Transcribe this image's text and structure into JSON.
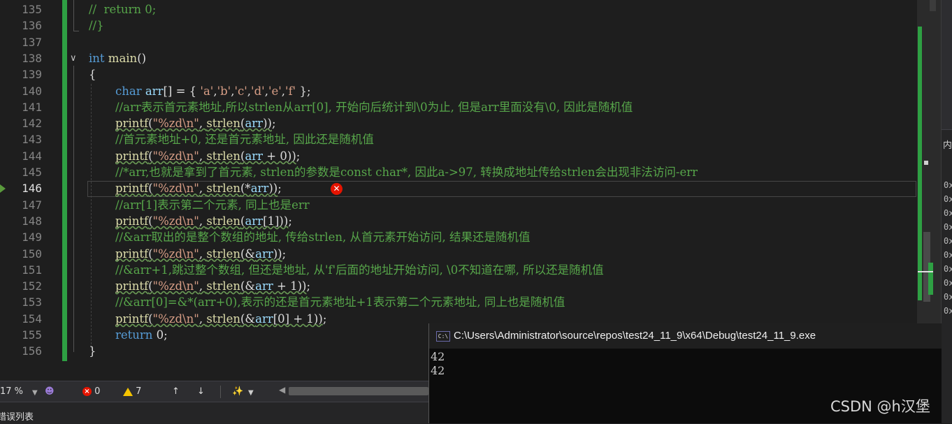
{
  "editor": {
    "lines": [
      {
        "num": "135",
        "parts": [
          {
            "c": "comment",
            "t": "//  return 0;"
          }
        ]
      },
      {
        "num": "136",
        "parts": [
          {
            "c": "comment",
            "t": "//}"
          }
        ]
      },
      {
        "num": "137",
        "parts": []
      },
      {
        "num": "138",
        "parts": [
          {
            "c": "kw",
            "t": "int"
          },
          {
            "c": "plain",
            "t": " "
          },
          {
            "c": "fn",
            "t": "main"
          },
          {
            "c": "plain",
            "t": "()"
          }
        ]
      },
      {
        "num": "139",
        "parts": [
          {
            "c": "plain",
            "t": "{"
          }
        ]
      },
      {
        "num": "140",
        "indent": true,
        "parts": [
          {
            "c": "kw",
            "t": "char"
          },
          {
            "c": "plain",
            "t": " "
          },
          {
            "c": "var",
            "t": "arr"
          },
          {
            "c": "plain",
            "t": "[] = { "
          },
          {
            "c": "str",
            "t": "'a'"
          },
          {
            "c": "plain",
            "t": ","
          },
          {
            "c": "str",
            "t": "'b'"
          },
          {
            "c": "plain",
            "t": ","
          },
          {
            "c": "str",
            "t": "'c'"
          },
          {
            "c": "plain",
            "t": ","
          },
          {
            "c": "str",
            "t": "'d'"
          },
          {
            "c": "plain",
            "t": ","
          },
          {
            "c": "str",
            "t": "'e'"
          },
          {
            "c": "plain",
            "t": ","
          },
          {
            "c": "str",
            "t": "'f'"
          },
          {
            "c": "plain",
            "t": " };"
          }
        ]
      },
      {
        "num": "141",
        "indent": true,
        "parts": [
          {
            "c": "comment",
            "t": "//arr表示首元素地址,所以strlen从arr[0], 开始向后统计到\\0为止, 但是arr里面没有\\0, 因此是随机值"
          }
        ]
      },
      {
        "num": "142",
        "indent": true,
        "parts": [
          {
            "c": "fn squig",
            "t": "printf"
          },
          {
            "c": "plain squig",
            "t": "("
          },
          {
            "c": "str squig",
            "t": "\"%zd\\n\""
          },
          {
            "c": "plain squig",
            "t": ", "
          },
          {
            "c": "fn squig",
            "t": "strlen"
          },
          {
            "c": "plain squig",
            "t": "("
          },
          {
            "c": "var squig",
            "t": "arr"
          },
          {
            "c": "plain squig",
            "t": "))"
          },
          {
            "c": "plain",
            "t": ";"
          }
        ]
      },
      {
        "num": "143",
        "indent": true,
        "parts": [
          {
            "c": "comment",
            "t": "//首元素地址+0, 还是首元素地址, 因此还是随机值"
          }
        ]
      },
      {
        "num": "144",
        "indent": true,
        "parts": [
          {
            "c": "fn squig",
            "t": "printf"
          },
          {
            "c": "plain squig",
            "t": "("
          },
          {
            "c": "str squig",
            "t": "\"%zd\\n\""
          },
          {
            "c": "plain squig",
            "t": ", "
          },
          {
            "c": "fn squig",
            "t": "strlen"
          },
          {
            "c": "plain squig",
            "t": "("
          },
          {
            "c": "var squig",
            "t": "arr"
          },
          {
            "c": "plain squig",
            "t": " + 0))"
          },
          {
            "c": "plain",
            "t": ";"
          }
        ]
      },
      {
        "num": "145",
        "indent": true,
        "parts": [
          {
            "c": "comment",
            "t": "//*arr,也就是拿到了首元素, strlen的参数是const char*, 因此a->97, 转换成地址传给strlen会出现非法访问-err"
          }
        ]
      },
      {
        "num": "146",
        "indent": true,
        "active": true,
        "parts": [
          {
            "c": "fn squig",
            "t": "printf"
          },
          {
            "c": "plain squig",
            "t": "("
          },
          {
            "c": "str squig",
            "t": "\"%zd\\n\""
          },
          {
            "c": "plain squig",
            "t": ", "
          },
          {
            "c": "fn squig",
            "t": "strlen"
          },
          {
            "c": "plain squig",
            "t": "(*"
          },
          {
            "c": "var squig",
            "t": "arr"
          },
          {
            "c": "plain squig",
            "t": "))"
          },
          {
            "c": "plain",
            "t": ";"
          }
        ]
      },
      {
        "num": "147",
        "indent": true,
        "parts": [
          {
            "c": "comment",
            "t": "//arr[1]表示第二个元素, 同上也是err"
          }
        ]
      },
      {
        "num": "148",
        "indent": true,
        "parts": [
          {
            "c": "fn squig",
            "t": "printf"
          },
          {
            "c": "plain squig",
            "t": "("
          },
          {
            "c": "str squig",
            "t": "\"%zd\\n\""
          },
          {
            "c": "plain squig",
            "t": ", "
          },
          {
            "c": "fn squig",
            "t": "strlen"
          },
          {
            "c": "plain squig",
            "t": "("
          },
          {
            "c": "var squig",
            "t": "arr"
          },
          {
            "c": "plain squig",
            "t": "[1]))"
          },
          {
            "c": "plain",
            "t": ";"
          }
        ]
      },
      {
        "num": "149",
        "indent": true,
        "parts": [
          {
            "c": "comment",
            "t": "//&arr取出的是整个数组的地址, 传给strlen, 从首元素开始访问, 结果还是随机值"
          }
        ]
      },
      {
        "num": "150",
        "indent": true,
        "parts": [
          {
            "c": "fn squig",
            "t": "printf"
          },
          {
            "c": "plain squig",
            "t": "("
          },
          {
            "c": "str squig",
            "t": "\"%zd\\n\""
          },
          {
            "c": "plain squig",
            "t": ", "
          },
          {
            "c": "fn squig",
            "t": "strlen"
          },
          {
            "c": "plain squig",
            "t": "(&"
          },
          {
            "c": "var squig",
            "t": "arr"
          },
          {
            "c": "plain squig",
            "t": "))"
          },
          {
            "c": "plain",
            "t": ";"
          }
        ]
      },
      {
        "num": "151",
        "indent": true,
        "parts": [
          {
            "c": "comment",
            "t": "//&arr+1,跳过整个数组, 但还是地址, 从'f'后面的地址开始访问, \\0不知道在哪, 所以还是随机值"
          }
        ]
      },
      {
        "num": "152",
        "indent": true,
        "parts": [
          {
            "c": "fn squig",
            "t": "printf"
          },
          {
            "c": "plain squig",
            "t": "("
          },
          {
            "c": "str squig",
            "t": "\"%zd\\n\""
          },
          {
            "c": "plain squig",
            "t": ", "
          },
          {
            "c": "fn squig",
            "t": "strlen"
          },
          {
            "c": "plain squig",
            "t": "(&"
          },
          {
            "c": "var squig",
            "t": "arr"
          },
          {
            "c": "plain squig",
            "t": " + 1))"
          },
          {
            "c": "plain",
            "t": ";"
          }
        ]
      },
      {
        "num": "153",
        "indent": true,
        "parts": [
          {
            "c": "comment",
            "t": "//&arr[0]=&*(arr+0),表示的还是首元素地址+1表示第二个元素地址, 同上也是随机值"
          }
        ]
      },
      {
        "num": "154",
        "indent": true,
        "parts": [
          {
            "c": "fn squig",
            "t": "printf"
          },
          {
            "c": "plain squig",
            "t": "("
          },
          {
            "c": "str squig",
            "t": "\"%zd\\n\""
          },
          {
            "c": "plain squig",
            "t": ", "
          },
          {
            "c": "fn squig",
            "t": "strlen"
          },
          {
            "c": "plain squig",
            "t": "(&"
          },
          {
            "c": "var squig",
            "t": "arr"
          },
          {
            "c": "plain squig",
            "t": "[0] + 1))"
          },
          {
            "c": "plain",
            "t": ";"
          }
        ]
      },
      {
        "num": "155",
        "indent": true,
        "parts": [
          {
            "c": "kw",
            "t": "return"
          },
          {
            "c": "plain",
            "t": " 0;"
          }
        ]
      },
      {
        "num": "156",
        "parts": [
          {
            "c": "plain",
            "t": "}"
          }
        ]
      }
    ],
    "error_glyph": "✕"
  },
  "statusbar": {
    "zoom": "17 %",
    "errors": "0",
    "warnings": "7",
    "up_arrow": "↑",
    "down_arrow": "↓"
  },
  "bottombar": {
    "label": "错误列表"
  },
  "right_panel": {
    "tab": "内",
    "hex_prefix": "0x"
  },
  "console": {
    "icon": "C:\\",
    "title": "C:\\Users\\Administrator\\source\\repos\\test24_11_9\\x64\\Debug\\test24_11_9.exe",
    "output": [
      "42",
      "42"
    ]
  },
  "watermark": "CSDN @h汉堡"
}
